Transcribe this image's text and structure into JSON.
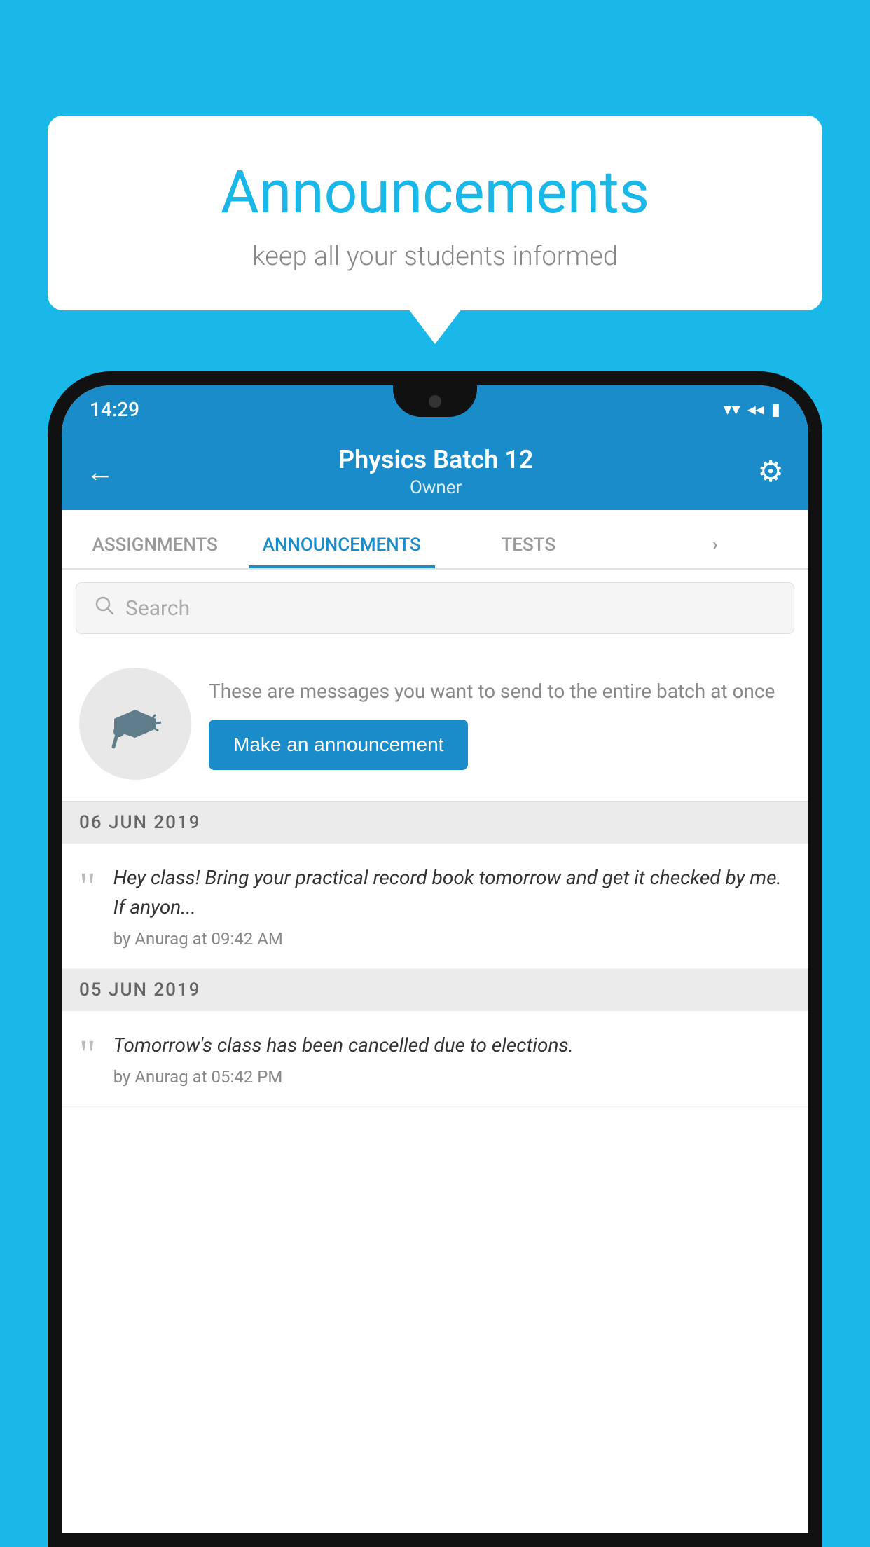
{
  "background_color": "#1ab8e8",
  "bubble": {
    "title": "Announcements",
    "subtitle": "keep all your students informed"
  },
  "status_bar": {
    "time": "14:29",
    "wifi_icon": "▼",
    "signal_icon": "◄",
    "battery_icon": "▮"
  },
  "app_bar": {
    "back_icon": "←",
    "title": "Physics Batch 12",
    "subtitle": "Owner",
    "settings_icon": "⚙"
  },
  "tabs": [
    {
      "label": "ASSIGNMENTS",
      "active": false
    },
    {
      "label": "ANNOUNCEMENTS",
      "active": true
    },
    {
      "label": "TESTS",
      "active": false
    },
    {
      "label": "›",
      "active": false
    }
  ],
  "search": {
    "placeholder": "Search"
  },
  "promo": {
    "icon": "📢",
    "text": "These are messages you want to send to the entire batch at once",
    "button_label": "Make an announcement"
  },
  "announcements": [
    {
      "date": "06  JUN  2019",
      "items": [
        {
          "text": "Hey class! Bring your practical record book tomorrow and get it checked by me. If anyon...",
          "meta": "by Anurag at 09:42 AM"
        }
      ]
    },
    {
      "date": "05  JUN  2019",
      "items": [
        {
          "text": "Tomorrow's class has been cancelled due to elections.",
          "meta": "by Anurag at 05:42 PM"
        }
      ]
    }
  ]
}
